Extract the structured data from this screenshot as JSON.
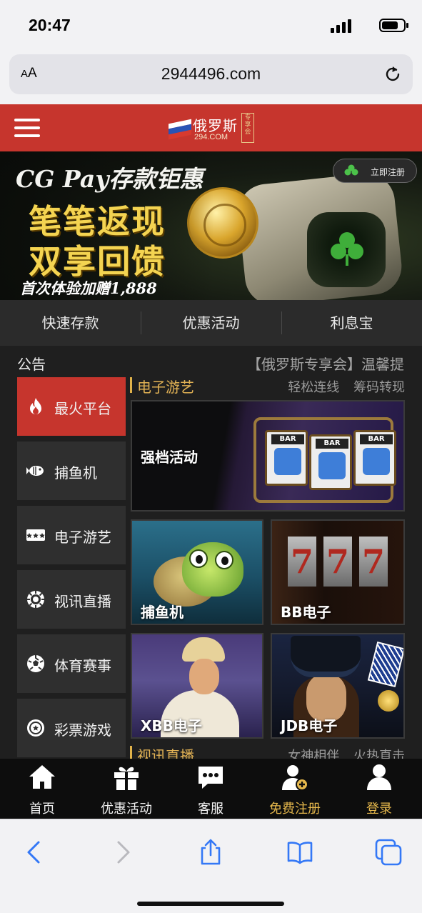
{
  "status": {
    "time": "20:47"
  },
  "browser": {
    "aa_large": "A",
    "aa_small": "A",
    "url": "2944496.com"
  },
  "header": {
    "logo_name": "俄罗斯",
    "logo_sub": "294.COM",
    "logo_tag": "专享会"
  },
  "banner": {
    "title": "CG Pay存款钜惠",
    "line1": "笔笔返现",
    "line2": "双享回馈",
    "line3": "首次体验加赠1,888",
    "register_button": "立即注册"
  },
  "quick_nav": [
    "快速存款",
    "优惠活动",
    "利息宝"
  ],
  "announcement": {
    "label": "公告",
    "text": "【俄罗斯专享会】温馨提"
  },
  "sidebar": [
    {
      "label": "最火平台",
      "icon": "flame-icon",
      "active": true
    },
    {
      "label": "捕鱼机",
      "icon": "fish-icon",
      "active": false
    },
    {
      "label": "电子游艺",
      "icon": "slot-icon",
      "active": false
    },
    {
      "label": "视讯直播",
      "icon": "chip-icon",
      "active": false
    },
    {
      "label": "体育赛事",
      "icon": "soccer-ball-icon",
      "active": false
    },
    {
      "label": "彩票游戏",
      "icon": "lottery-icon",
      "active": false
    }
  ],
  "sections": [
    {
      "title": "电子游艺",
      "tags": "轻松连线 筹码转现"
    },
    {
      "title": "视讯直播",
      "tags": "女神相伴 火热直击"
    }
  ],
  "cards": [
    {
      "label": "强档活动"
    },
    {
      "label": "捕鱼机"
    },
    {
      "label": "BB电子"
    },
    {
      "label": "XBB电子"
    },
    {
      "label": "JDB电子"
    }
  ],
  "bottom_nav": [
    {
      "label": "首页",
      "icon": "home-icon"
    },
    {
      "label": "优惠活动",
      "icon": "gift-icon"
    },
    {
      "label": "客服",
      "icon": "chat-icon"
    },
    {
      "label": "免费注册",
      "icon": "add-user-icon"
    },
    {
      "label": "登录",
      "icon": "user-icon"
    }
  ],
  "colors": {
    "accent_red": "#c6352d",
    "gold": "#e3b355",
    "dark_bg": "#1f1f1f",
    "ios_blue": "#3478f6"
  }
}
